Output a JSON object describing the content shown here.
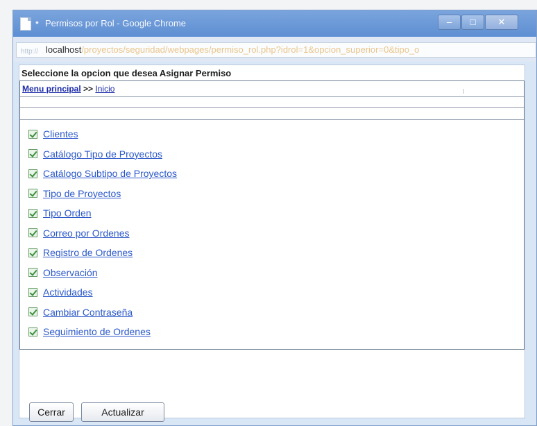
{
  "window": {
    "title": "Permisos por Rol - Google Chrome",
    "controls": {
      "minimize": "–",
      "maximize": "□",
      "close": "✕"
    }
  },
  "address": {
    "host": "localhost",
    "path": "/proyectos/seguridad/webpages/permiso_rol.php?idrol=1&opcion_superior=0&tipo_o"
  },
  "page": {
    "heading": "Seleccione la opcion que desea Asignar Permiso",
    "breadcrumb": {
      "root": "Menu principal",
      "separator": ">>",
      "current": "Inicio"
    },
    "permissions": [
      {
        "label": "Clientes",
        "checked": true
      },
      {
        "label": "Catálogo Tipo de Proyectos",
        "checked": true
      },
      {
        "label": "Catálogo Subtipo de Proyectos",
        "checked": true
      },
      {
        "label": "Tipo de Proyectos",
        "checked": true
      },
      {
        "label": "Tipo Orden",
        "checked": true
      },
      {
        "label": "Correo por Ordenes",
        "checked": true
      },
      {
        "label": "Registro de Ordenes",
        "checked": true
      },
      {
        "label": "Observación",
        "checked": true
      },
      {
        "label": "Actividades",
        "checked": true
      },
      {
        "label": "Cambiar Contraseña",
        "checked": true
      },
      {
        "label": "Seguimiento de Ordenes",
        "checked": true
      }
    ],
    "buttons": {
      "close": "Cerrar",
      "update": "Actualizar"
    }
  }
}
